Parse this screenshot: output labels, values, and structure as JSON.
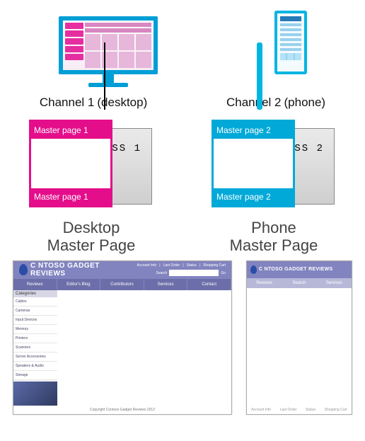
{
  "channels": {
    "desktop": {
      "label": "Channel 1",
      "suffix": "(desktop)"
    },
    "phone": {
      "label": "Channel 2",
      "suffix": "(phone)"
    }
  },
  "stacks": {
    "desktop": {
      "master_top": "Master page 1",
      "master_bottom": "Master page 1",
      "css": "CSS 1"
    },
    "phone": {
      "master_top": "Master page 2",
      "master_bottom": "Master page 2",
      "css": "CSS 2"
    }
  },
  "titles": {
    "desktop": {
      "line1": "Desktop",
      "line2": "Master Page"
    },
    "phone": {
      "line1": "Phone",
      "line2": "Master Page"
    }
  },
  "site": {
    "brand": "C  NTOSO GADGET REVIEWS",
    "header_links": [
      "Account Info",
      "Last Order",
      "Status",
      "Shopping Cart"
    ],
    "search_label": "Search",
    "go": "Go",
    "nav": [
      "Reviews",
      "Editor's Blog",
      "Contributors",
      "Services",
      "Contact"
    ],
    "side_header": "Categories",
    "side_items": [
      "Cables",
      "Cameras",
      "Input Devices",
      "Memory",
      "Printers",
      "Scanners",
      "Server Accessories",
      "Speakers & Audio",
      "Storage"
    ],
    "footer": "Copyright Contoso Gadget Reviews 2012"
  },
  "phone_site": {
    "brand": "C  NTOSO GADGET REVIEWS",
    "nav": [
      "Reviews",
      "Search",
      "Services"
    ],
    "footer": [
      "Account Info",
      "Last Order",
      "Status",
      "Shopping Cart"
    ]
  }
}
